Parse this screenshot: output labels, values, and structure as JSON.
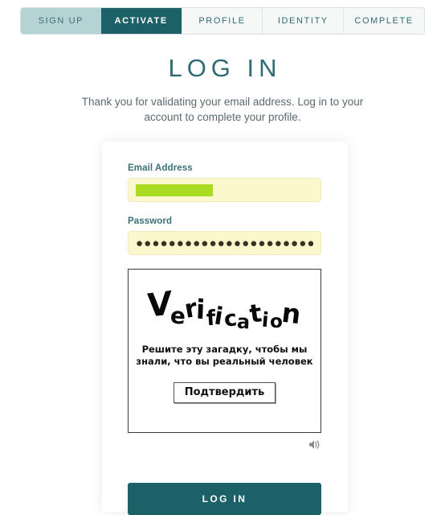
{
  "stepper": {
    "steps": [
      {
        "label": "SIGN UP",
        "state": "done"
      },
      {
        "label": "ACTIVATE",
        "state": "active"
      },
      {
        "label": "PROFILE",
        "state": "todo"
      },
      {
        "label": "IDENTITY",
        "state": "todo"
      },
      {
        "label": "COMPLETE",
        "state": "todo"
      }
    ]
  },
  "header": {
    "title": "LOG IN",
    "subtitle": "Thank you for validating your email address. Log in to your account to complete your profile."
  },
  "form": {
    "email": {
      "label": "Email Address",
      "value": "",
      "redacted": true
    },
    "password": {
      "label": "Password",
      "value": "●●●●●●●●●●●●●●●●●●●●●●●●●●●●●●●●"
    },
    "submit_label": "LOG IN"
  },
  "captcha": {
    "wordmark": "Verification",
    "wordmark_letters": [
      "V",
      "e",
      "r",
      "i",
      "f",
      "i",
      "c",
      "a",
      "t",
      "i",
      "o",
      "n"
    ],
    "prompt": "Решите эту загадку, чтобы мы знали, что вы реальный человек",
    "button_label": "Подтвердить",
    "audio_icon": "speaker-icon"
  },
  "colors": {
    "accent_teal": "#1c6068",
    "step_done": "#b5d3d4",
    "field_bg": "#fbf8ce",
    "redaction_green": "#aada23",
    "title": "#2f6d74"
  }
}
